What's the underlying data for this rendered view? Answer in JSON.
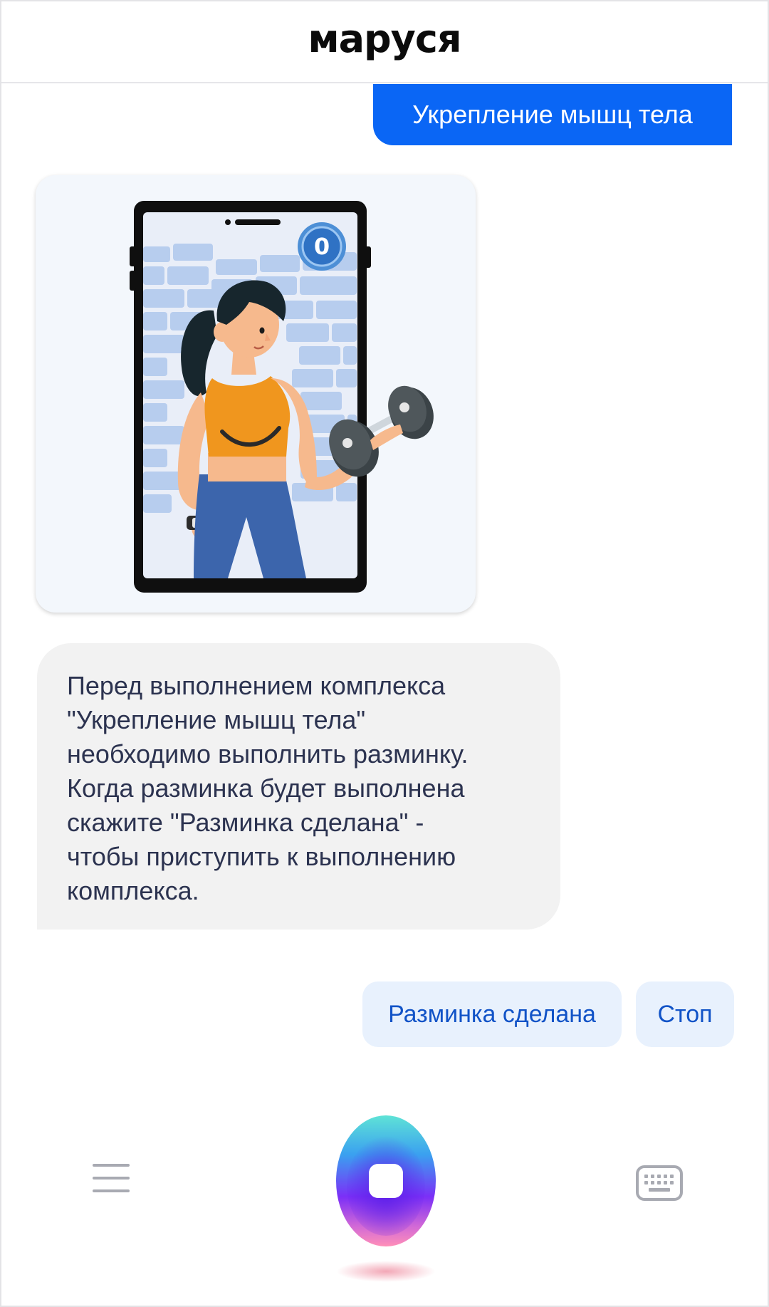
{
  "header": {
    "logo": "маруся"
  },
  "chat": {
    "user_message": "Укрепление мышц тела",
    "illustration": {
      "counter_badge": "0"
    },
    "bot_message_lines": [
      "Перед выполнением комплекса",
      "\"Укрепление мышц тела\"",
      "необходимо выполнить разминку.",
      "Когда разминка будет выполнена",
      "скажите \"Разминка сделана\" -",
      "чтобы приступить к выполнению",
      "комплекса."
    ]
  },
  "suggestions": [
    "Разминка сделана",
    "Стоп"
  ],
  "bottom_bar": {
    "left_icon": "menu-icon",
    "center_icon": "voice-assistant-orb-icon",
    "right_icon": "keyboard-icon"
  },
  "colors": {
    "accent": "#0a66f5",
    "suggest_bg": "#e8f1fd",
    "suggest_text": "#1153c7",
    "bot_bubble_bg": "#f2f2f2",
    "bot_text": "#2c3350"
  }
}
